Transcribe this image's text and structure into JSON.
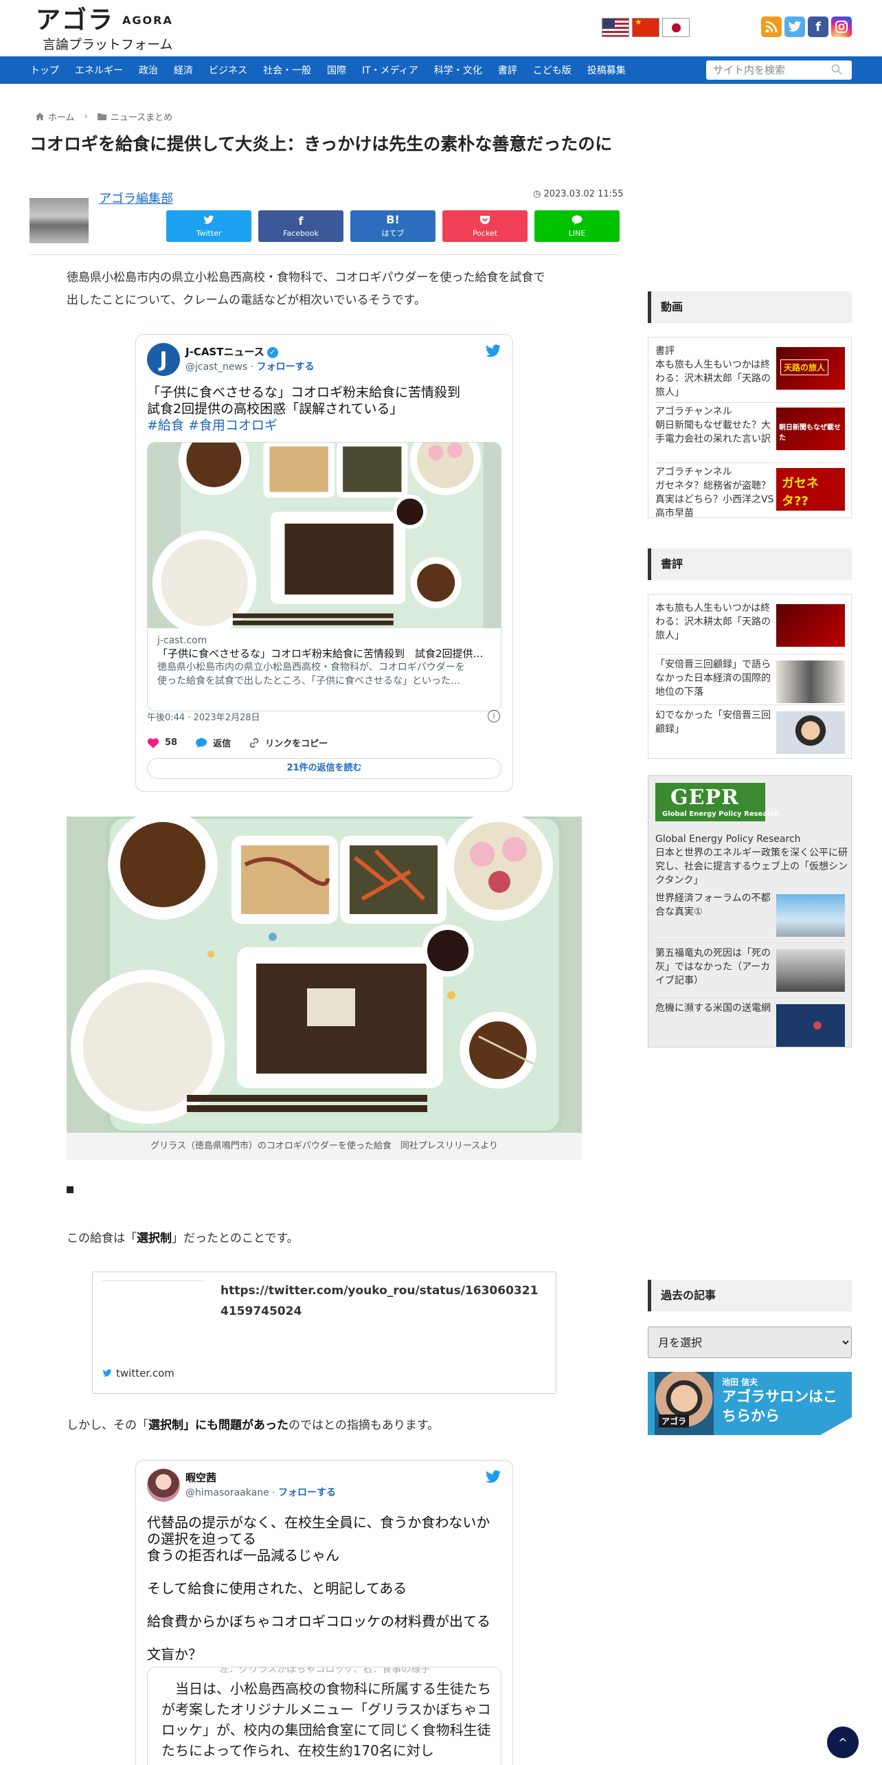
{
  "header": {
    "logo_main": "アゴラ",
    "logo_en": "AGORA",
    "logo_sub": "言論プラットフォーム",
    "flags": [
      "us",
      "cn",
      "jp"
    ],
    "social_icons": [
      "rss-icon",
      "twitter-icon",
      "facebook-icon",
      "instagram-icon"
    ]
  },
  "nav": {
    "items": [
      "トップ",
      "エネルギー",
      "政治",
      "経済",
      "ビジネス",
      "社会・一般",
      "国際",
      "IT・メディア",
      "科学・文化",
      "書評",
      "こども版",
      "投稿募集"
    ],
    "search_placeholder": "サイト内を検索"
  },
  "breadcrumb": {
    "home": "ホーム",
    "category": "ニュースまとめ"
  },
  "article": {
    "title": "コオロギを給食に提供して大炎上：きっかけは先生の素朴な善意だったのに",
    "author": "アゴラ編集部",
    "date": "2023.03.02 11:55",
    "share": [
      {
        "label": "Twitter",
        "icon": "twitter-icon"
      },
      {
        "label": "Facebook",
        "icon": "facebook-icon"
      },
      {
        "label": "はてブ",
        "icon": "hatena-icon"
      },
      {
        "label": "Pocket",
        "icon": "pocket-icon"
      },
      {
        "label": "LINE",
        "icon": "line-icon"
      }
    ],
    "intro_1": "徳島県小松島市内の県立小松島西高校・食物科で、コオロギパウダーを使った給食を試食で",
    "intro_2": "出したことについて、クレームの電話などが相次いでいるそうです。",
    "caption": "グリラス（徳島県鳴門市）のコオロギパウダーを使った給食　同社プレスリリースより",
    "bullet": "■",
    "p2_pre": "この給食は「",
    "p2_bold": "選択制",
    "p2_post": "」だったとのことです。",
    "p3_pre": "しかし、その「",
    "p3_bold": "選択制」にも問題があった",
    "p3_post": "のではとの指摘もあります。"
  },
  "tweet1": {
    "name": "J-CASTニュース",
    "handle": "@jcast_news",
    "dot": " · ",
    "follow": "フォローする",
    "text_1": "「子供に食べさせるな」コオロギ粉末給食に苦情殺到",
    "text_2": "試食2回提供の高校困惑「誤解されている」",
    "hashtags": "#給食 #食用コオロギ",
    "link_domain": "j-cast.com",
    "link_title": "「子供に食べさせるな」コオロギ粉末給食に苦情殺到　試食2回提供の…",
    "link_desc_1": "徳島県小松島市内の県立小松島西高校・食物科が、コオロギパウダーを",
    "link_desc_2": "使った給食を試食で出したところ、「子供に食べさせるな」といった…",
    "time": "午後0:44 · 2023年2月28日",
    "likes": "58",
    "reply": "返信",
    "copy": "リンクをコピー",
    "read_replies": "21件の返信を読む"
  },
  "embed": {
    "url": "https://twitter.com/youko_rou/status/1630603214159745024",
    "site": "twitter.com"
  },
  "tweet2": {
    "name": "暇空茜",
    "handle": "@himasoraakane",
    "dot": " · ",
    "follow": "フォローする",
    "line_1": "代替品の提示がなく、在校生全員に、食うか食わないか",
    "line_2": "の選択を迫ってる",
    "line_3": "食うの拒否れば一品減るじゃん",
    "line_4": "そして給食に使用された、と明記してある",
    "line_5": "給食費からかぼちゃコオロギコロッケの材料費が出てる",
    "line_6": "文盲か？",
    "quote_top": "左：グリラスかぼちゃコロッケ、右：食事の様子",
    "quote_text": "当日は、小松島西高校の食物科に所属する生徒たちが考案したオリジナルメニュー「グリラスかぼちゃコロッケ」が、校内の集団給食室にて同じく食物科生徒たちによって作られ、在校生約170名に対し"
  },
  "sidebar": {
    "video_head": "動画",
    "videos": [
      {
        "text": "書評\n本も旅も人生もいつかは終わる：沢木耕太郎「天路の旅人」",
        "thumb": "天路の旅人"
      },
      {
        "text": "アゴラチャンネル\n朝日新聞もなぜ載せた？大手電力会社の呆れた言い訳",
        "thumb": "朝日新聞もなぜ載せた"
      },
      {
        "text": "アゴラチャンネル\nガセネタ？総務省が盗聴？真実はどちら？小西洋之VS高市早苗",
        "thumb": "ガセネタ??"
      }
    ],
    "review_head": "書評",
    "reviews": [
      {
        "text": "本も旅も人生もいつかは終わる：沢木耕太郎「天路の旅人」"
      },
      {
        "text": "「安倍晋三回顧録」で語らなかった日本経済の国際的地位の下落"
      },
      {
        "text": "幻でなかった「安倍晋三回顧録」"
      }
    ],
    "gepr": {
      "logo": "GEPR",
      "logo_sub": "Global Energy Policy Research",
      "desc_1": "Global Energy Policy Research",
      "desc_2": "日本と世界のエネルギー政策を深く公平に研究し、社会に提言するウェブ上の「仮想シンクタンク」",
      "items": [
        {
          "text": "世界経済フォーラムの不都合な真実①"
        },
        {
          "text": "第五福竜丸の死因は「死の灰」ではなかった（アーカイブ記事）"
        },
        {
          "text": "危機に瀕する米国の送電網"
        }
      ]
    },
    "archive_head": "過去の記事",
    "archive_select": "月を選択",
    "salon_name": "池田 信夫",
    "salon_text": "アゴラサロンはこちらから",
    "salon_logo": "アゴラ"
  },
  "scroll_top": "^"
}
